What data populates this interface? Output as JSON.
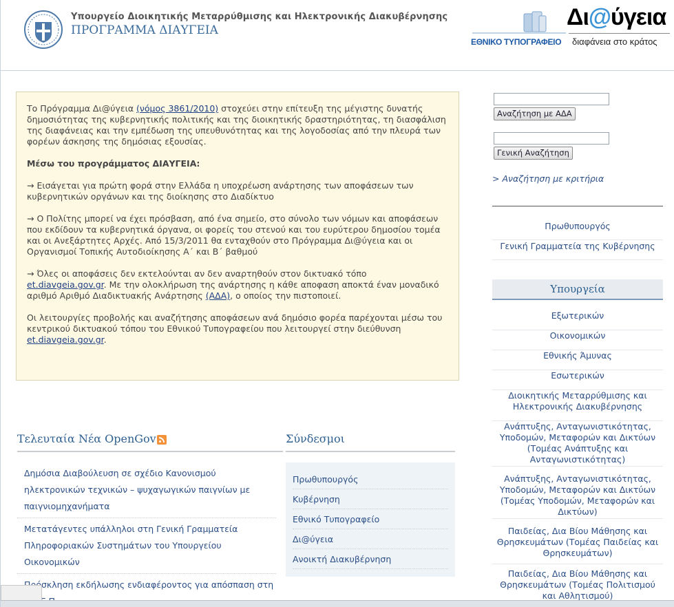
{
  "header": {
    "ministry": "Υπουργείο Διοικητικής Μεταρρύθμισης και Ηλεκτρονικής Διακυβέρνησης",
    "program": "ΠΡΟΓΡΑΜΜΑ ΔΙΑΥΓΕΙΑ",
    "printing_office": "ΕΘΝΙΚΟ ΤΥΠΟΓΡΑΦΕΙΟ",
    "logo_prefix": "Δι",
    "logo_at": "@",
    "logo_suffix": "ύγεια",
    "logo_tagline": "διαφάνεια στο κράτος"
  },
  "intro": {
    "p1_a": "Το Πρόγραμμα Δι@ύγεια ",
    "p1_link": "(νόμος 3861/2010)",
    "p1_b": " στοχεύει στην επίτευξη της μέγιστης δυνατής δημοσιότητας της κυβερνητικής πολιτικής και της διοικητικής δραστηριότητας, τη διασφάλιση της διαφάνειας και την εμπέδωση της υπευθυνότητας και της λογοδοσίας από την πλευρά των φορέων άσκησης της δημόσιας εξουσίας.",
    "heading": "Μέσω του προγράμματος ΔΙΑΥΓΕΙΑ:",
    "p2": "→ Εισάγεται για πρώτη φορά στην Ελλάδα η υποχρέωση ανάρτησης των αποφάσεων των κυβερνητικών οργάνων και της διοίκησης στο Διαδίκτυο",
    "p3": "→ Ο Πολίτης μπορεί να έχει πρόσβαση, από ένα σημείο, στο σύνολο των νόμων και αποφάσεων που εκδίδουν τα κυβερνητικά όργανα, οι φορείς του στενού και του ευρύτερου δημοσίου τομέα και οι Ανεξάρτητες Αρχές. Από 15/3/2011 θα ενταχθούν στο Πρόγραμμα Δι@ύγεια και οι Οργανισμοί Τοπικής Αυτοδιοίκησης Α΄ και Β΄ βαθμού",
    "p4_a": "→ Όλες οι αποφάσεις δεν εκτελούνται αν δεν αναρτηθούν στον δικτυακό τόπο ",
    "p4_link1": "et.diavgeia.gov.gr",
    "p4_b": ". Με την ολοκλήρωση της ανάρτησης η κάθε αποφαση αποκτά έναν μοναδικό αριθμό Αριθμό Διαδικτυακής Ανάρτησης ",
    "p4_link2": "(ΑΔΑ)",
    "p4_c": ", ο οποίος την πιστοποιεί.",
    "p5_a": "Οι λειτουργίες προβολής και αναζήτησης αποφάσεων ανά δημόσιο φορέα παρέχονται μέσω του κεντρικού δικτυακού τόπου του Εθνικού Τυπογραφείου που λειτουργεί στην διεύθυνση ",
    "p5_link": "et.diavgeia.gov.gr",
    "p5_b": "."
  },
  "news": {
    "title": "Τελευταία Νέα OpenGov",
    "items": [
      "Δημόσια Διαβούλευση σε σχέδιο Κανονισμού ηλεκτρονικών τεχνικών – ψυχαγωγικών παιγνίων με παιγνιομηχανήματα",
      "Μετατάγεντες υπάλληλοι στη Γενική Γραμματεία Πληροφοριακών Συστημάτων του Υπουργείου Οικονομικών",
      "Πρόσκληση εκδήλωσης ενδιαφέροντος για απόσπαση στη Ε.Ε.Ε.Π."
    ]
  },
  "links": {
    "title": "Σύνδεσμοι",
    "items": [
      "Πρωθυπουργός",
      "Κυβέρνηση",
      "Εθνικό Τυπογραφείο",
      "Δι@ύγεια",
      "Ανοικτή Διακυβέρνηση"
    ]
  },
  "sidebar": {
    "ada_button": "Αναζήτηση με ΑΔΑ",
    "general_button": "Γενική Αναζήτηση",
    "criteria_link": "> Αναζήτηση με κριτήρια",
    "top_links": [
      "Πρωθυπουργός",
      "Γενική Γραμματεία της Κυβέρνησης"
    ],
    "ministries_header": "Υπουργεία",
    "ministries": [
      "Εξωτερικών",
      "Οικονομικών",
      "Εθνικής Άμυνας",
      "Εσωτερικών",
      "Διοικητικής Μεταρρύθμισης και Ηλεκτρονικής Διακυβέρνησης",
      "Ανάπτυξης, Ανταγωνιστικότητας, Υποδομών, Μεταφορών και Δικτύων (Τομέας Ανάπτυξης και Ανταγωνιστικότητας)",
      "Ανάπτυξης, Ανταγωνιστικότητας, Υποδομών, Μεταφορών και Δικτύων (Τομέας Υποδομών, Μεταφορών και Δικτύων)",
      "Παιδείας, Δια Βίου Μάθησης και Θρησκευμάτων (Τομέας Παιδείας και Θρησκευμάτων)",
      "Παιδείας, Δια Βίου Μάθησης και Θρησκευμάτων (Τομέας Πολιτισμού και Αθλητισμού)"
    ]
  },
  "colors": {
    "link": "#2c4f86",
    "title": "#2c5f90",
    "intro_bg": "#fdf9e2",
    "logo_at": "#3d95d8"
  }
}
